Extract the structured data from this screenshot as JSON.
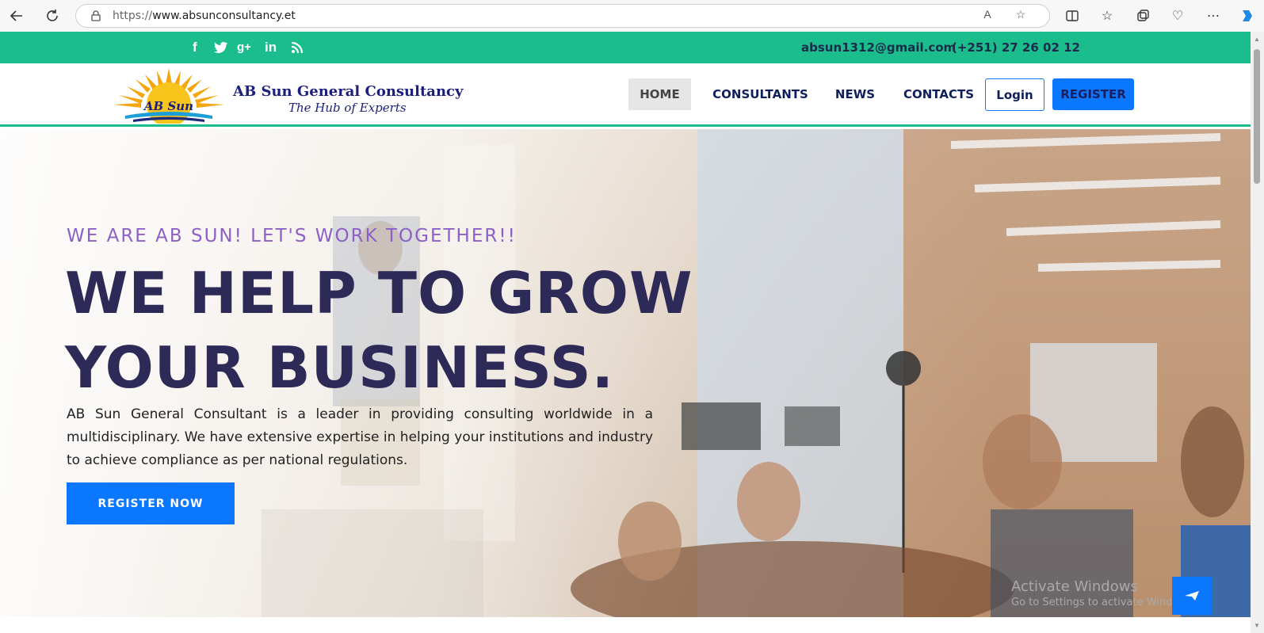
{
  "browser": {
    "url_protocol": "https://",
    "url_host": "www.absunconsultancy.et",
    "icons": [
      "back-icon",
      "refresh-icon",
      "lock-icon",
      "read-aloud-icon",
      "favorite-star-icon",
      "split-screen-icon",
      "favorites-icon",
      "collections-icon",
      "browser-essentials-icon",
      "more-icon",
      "copilot-icon"
    ]
  },
  "topbar": {
    "social": [
      "f",
      "t",
      "g+",
      "in",
      "rss"
    ],
    "email": "absun1312@gmail.com",
    "phone": "(+251) 27 26 02 12"
  },
  "header": {
    "logo_text": "AB Sun",
    "brand_title": "AB Sun General Consultancy",
    "brand_tagline": "The Hub of Experts",
    "nav": [
      {
        "label": "HOME"
      },
      {
        "label": "CONSULTANTS"
      },
      {
        "label": "NEWS"
      },
      {
        "label": "CONTACTS"
      }
    ],
    "login_label": "Login",
    "register_label": "REGISTER"
  },
  "hero": {
    "subtitle": "WE ARE AB SUN! LET'S WORK TOGETHER!!",
    "title_line1": "WE HELP TO GROW",
    "title_line2": "YOUR BUSINESS.",
    "description": "AB Sun General Consultant is a leader in providing consulting worldwide in a multidisciplinary. We have extensive expertise in helping your institutions and industry to achieve compliance as per national regulations.",
    "cta_label": "REGISTER NOW"
  },
  "windows_watermark": {
    "line1": "Activate Windows",
    "line2": "Go to Settings to activate Windows."
  },
  "colors": {
    "topbar_green": "#1bbd8c",
    "brand_navy": "#1b1f7a",
    "accent_blue": "#0b77ff",
    "subtitle_purple": "#8c60c8",
    "title_dark": "#2d2a57"
  }
}
